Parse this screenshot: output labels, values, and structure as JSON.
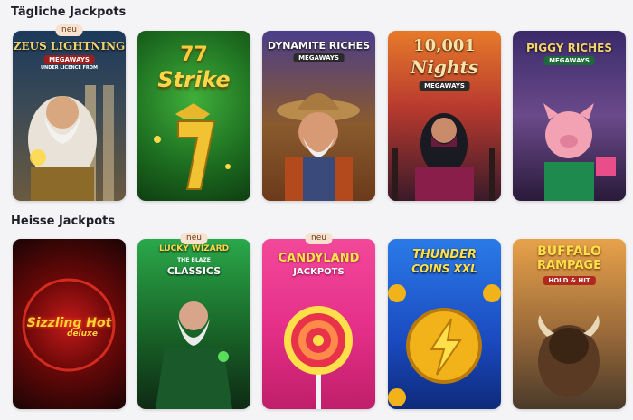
{
  "sections": [
    {
      "title": "Tägliche Jackpots",
      "games": [
        {
          "logo": "ZEUS LIGHTNING",
          "tag": "MEGAWAYS",
          "note": "UNDER LICENCE FROM",
          "badge": "neu"
        },
        {
          "logo": "Strike",
          "number": "77"
        },
        {
          "logo": "DYNAMITE RICHES",
          "tag": "MEGAWAYS"
        },
        {
          "logo": "10,001",
          "logo2": "Nights",
          "tag": "MEGAWAYS"
        },
        {
          "logo": "PIGGY RICHES",
          "tag": "MEGAWAYS"
        }
      ]
    },
    {
      "title": "Heisse Jackpots",
      "games": [
        {
          "logo": "Sizzling Hot",
          "logo2": "deluxe"
        },
        {
          "logo": "LUCKY WIZARD",
          "logo2": "CLASSICS",
          "note": "THE BLAZE",
          "badge": "neu"
        },
        {
          "logo": "CANDYLAND",
          "logo2": "JACKPOTS",
          "badge": "neu"
        },
        {
          "logo": "THUNDER",
          "logo2": "COINS XXL"
        },
        {
          "logo": "BUFFALO",
          "logo2": "RAMPAGE",
          "tag": "HOLD & HIT"
        }
      ]
    }
  ],
  "colors": {
    "background": "#f4f4f6",
    "badge": "#f7e2cf",
    "title": "#1f1f29"
  }
}
